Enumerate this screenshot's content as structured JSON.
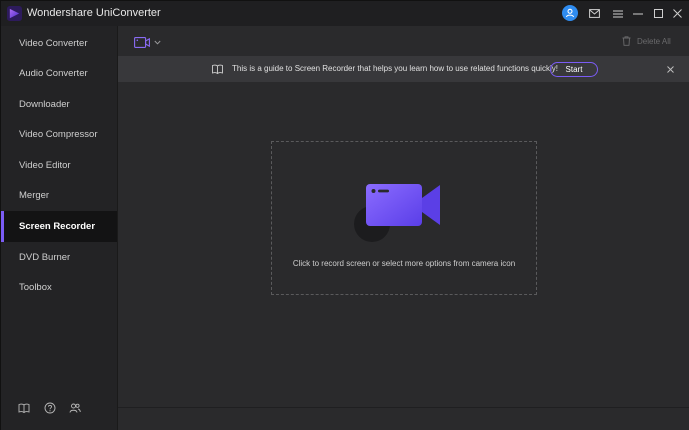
{
  "app": {
    "title": "Wondershare UniConverter",
    "icons": [
      "app-logo-icon",
      "user-avatar-icon",
      "mail-icon",
      "menu-icon",
      "minimize-icon",
      "maximize-icon",
      "close-icon"
    ]
  },
  "sidebar": {
    "items": [
      {
        "label": "Video Converter",
        "active": false
      },
      {
        "label": "Audio Converter",
        "active": false
      },
      {
        "label": "Downloader",
        "active": false
      },
      {
        "label": "Video Compressor",
        "active": false
      },
      {
        "label": "Video Editor",
        "active": false
      },
      {
        "label": "Merger",
        "active": false
      },
      {
        "label": "Screen Recorder",
        "active": true
      },
      {
        "label": "DVD Burner",
        "active": false
      },
      {
        "label": "Toolbox",
        "active": false
      }
    ],
    "footer_icons": [
      "book-icon",
      "help-icon",
      "community-icon"
    ]
  },
  "toolbar": {
    "recorder_icon": "camera-dropdown-icon",
    "delete_all_label": "Delete All"
  },
  "banner": {
    "text": "This is a guide to Screen Recorder that helps you learn how to use related functions quickly!",
    "start_label": "Start"
  },
  "dropzone": {
    "text": "Click to record screen or select more options from camera icon"
  },
  "colors": {
    "accent": "#7b5cf5",
    "avatar": "#2f8cf0",
    "background": "#2a2a2c",
    "sidebar": "#232325"
  }
}
